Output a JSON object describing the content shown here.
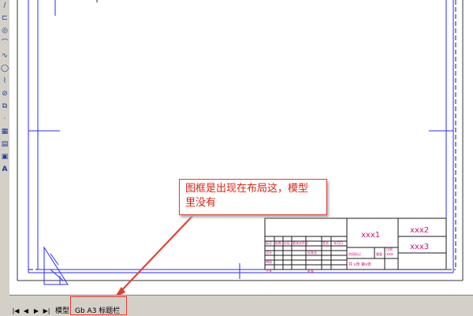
{
  "annotation": {
    "text_line1": "图框是出现在布局这，模型",
    "text_line2": "里没有"
  },
  "title_block": {
    "drawing_name": "xxx1",
    "drawing_code": "xxx2",
    "company": "xxx3",
    "scale_text": "xxx",
    "sheet_text": "共 x张 第x张",
    "row_labels": [
      "标记",
      "处数",
      "分区",
      "更改文件号",
      "签名",
      "年月日"
    ],
    "role_labels": [
      "设计",
      "审核",
      "工艺"
    ],
    "standard_label": "标准化",
    "approve_label": "批准",
    "stage_labels": [
      "阶段标记",
      "重量",
      "比例"
    ]
  },
  "tabs": {
    "model": "模型",
    "layout": "Gb A3 标题栏"
  },
  "nav_buttons": [
    "|◀",
    "◀",
    "▶",
    "▶|"
  ],
  "toolbar_icons": [
    "line-icon",
    "polyline-icon",
    "circle-icon",
    "arc-icon",
    "spline-icon",
    "ellipse-icon",
    "revision-icon",
    "hatch-icon",
    "insert-icon",
    "point-icon",
    "table-icon",
    "gradient-icon",
    "region-icon",
    "mtext-icon"
  ],
  "toolbar_glyphs": [
    "/",
    "⊏",
    "◎",
    "⌒",
    "∿",
    "◯",
    "⌇",
    "⊘",
    "⧉",
    "·",
    "▦",
    "▤",
    "▣",
    "A"
  ],
  "colors": {
    "frame": "#2a2aff",
    "title_text": "#d01080",
    "annotation": "#e02010"
  }
}
